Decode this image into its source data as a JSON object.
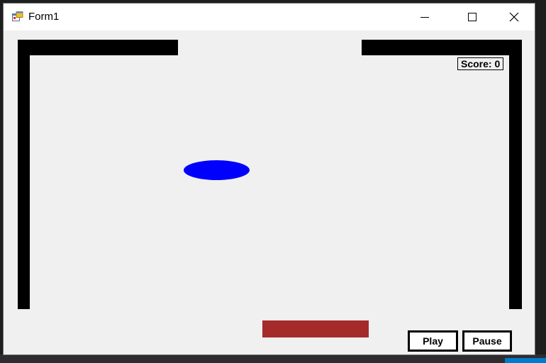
{
  "window": {
    "title": "Form1"
  },
  "game": {
    "score_label": "Score: 0",
    "score_value": 0,
    "colors": {
      "background": "#f0f0f0",
      "walls": "#000000",
      "ball": "#0000ff",
      "paddle": "#a52a2a"
    }
  },
  "controls": {
    "play_label": "Play",
    "pause_label": "Pause"
  },
  "icons": {
    "app": "app-form-icon",
    "minimize": "minimize-icon",
    "maximize": "maximize-icon",
    "close": "close-icon"
  }
}
